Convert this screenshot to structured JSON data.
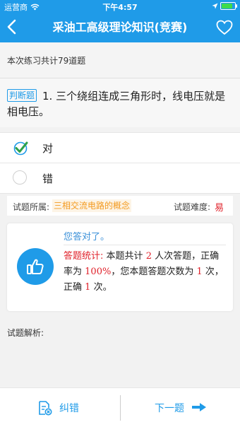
{
  "status_bar": {
    "carrier": "运营商",
    "time": "下午4:57",
    "battery_level": 0.9
  },
  "nav": {
    "title": "采油工高级理论知识(竞赛)"
  },
  "practice": {
    "count_text": "本次练习共计79道题"
  },
  "question": {
    "type_tag": "判断题",
    "text": "1. 三个绕组连成三角形时，线电压就是相电压。"
  },
  "options": [
    {
      "label": "对",
      "selected": true
    },
    {
      "label": "错",
      "selected": false
    }
  ],
  "info": {
    "belongs_label": "试题所属:",
    "category": "三相交流电路的概念",
    "difficulty_label": "试题难度:",
    "difficulty": "易"
  },
  "result": {
    "message": "您答对了。",
    "stats_label": "答题统计:",
    "t1": "本题共计",
    "total": "2",
    "t2": "人次答题，正确率为",
    "rate": "100%",
    "t3": "，您本题答题次数为",
    "my_count": "1",
    "t4": "次，正确",
    "my_correct": "1",
    "t5": "次。"
  },
  "analysis": {
    "label": "试题解析:"
  },
  "bottom": {
    "report_label": "纠错",
    "next_label": "下一题"
  },
  "colors": {
    "primary": "#1f9be8",
    "accent_red": "#e0212a",
    "tag_orange": "#f39a1f"
  }
}
